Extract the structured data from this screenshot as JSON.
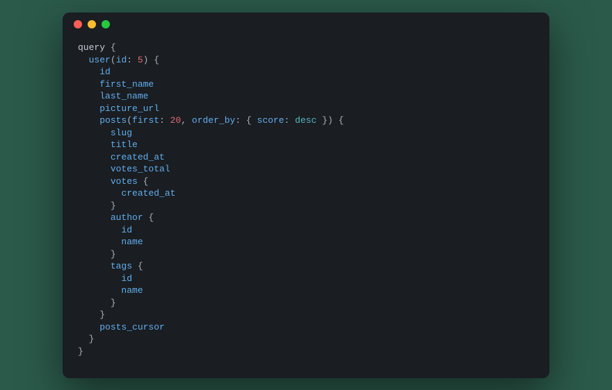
{
  "traffic_lights": {
    "red": "#ff5f56",
    "yellow": "#ffbd2e",
    "green": "#27c93f"
  },
  "code": {
    "l01_kw": "query",
    "l02_user": "user",
    "l02_id_key": "id",
    "l02_id_val": "5",
    "l03_id": "id",
    "l04_first_name": "first_name",
    "l05_last_name": "last_name",
    "l06_picture_url": "picture_url",
    "l07_posts": "posts",
    "l07_first_key": "first",
    "l07_first_val": "20",
    "l07_orderby_key": "order_by",
    "l07_score_key": "score",
    "l07_score_val": "desc",
    "l08_slug": "slug",
    "l09_title": "title",
    "l10_created_at": "created_at",
    "l11_votes_total": "votes_total",
    "l12_votes": "votes",
    "l13_created_at": "created_at",
    "l15_author": "author",
    "l16_id": "id",
    "l17_name": "name",
    "l19_tags": "tags",
    "l20_id": "id",
    "l21_name": "name",
    "l24_posts_cursor": "posts_cursor"
  }
}
